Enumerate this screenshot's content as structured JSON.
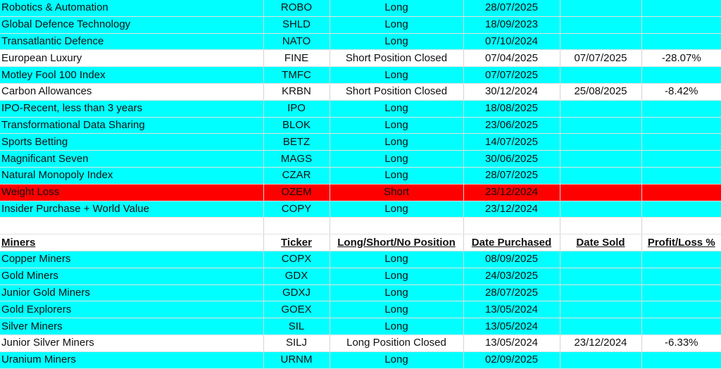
{
  "rows": [
    {
      "kind": "cyan",
      "cells": [
        "Robotics & Automation",
        "ROBO",
        "Long",
        "28/07/2025",
        "",
        ""
      ]
    },
    {
      "kind": "cyan",
      "cells": [
        "Global Defence Technology",
        "SHLD",
        "Long",
        "18/09/2023",
        "",
        ""
      ]
    },
    {
      "kind": "cyan",
      "cells": [
        "Transatlantic Defence",
        "NATO",
        "Long",
        "07/10/2024",
        "",
        ""
      ]
    },
    {
      "kind": "white",
      "cells": [
        "European Luxury",
        "FINE",
        "Short Position Closed",
        "07/04/2025",
        "07/07/2025",
        "-28.07%"
      ]
    },
    {
      "kind": "cyan",
      "cells": [
        "Motley Fool 100 Index",
        "TMFC",
        "Long",
        "07/07/2025",
        "",
        ""
      ]
    },
    {
      "kind": "white",
      "cells": [
        "Carbon Allowances",
        "KRBN",
        "Short Position Closed",
        "30/12/2024",
        "25/08/2025",
        "-8.42%"
      ]
    },
    {
      "kind": "cyan",
      "cells": [
        "IPO-Recent, less than 3 years",
        "IPO",
        "Long",
        "18/08/2025",
        "",
        ""
      ]
    },
    {
      "kind": "cyan",
      "cells": [
        "Transformational Data Sharing",
        "BLOK",
        "Long",
        "23/06/2025",
        "",
        ""
      ]
    },
    {
      "kind": "cyan",
      "cells": [
        "Sports Betting",
        "BETZ",
        "Long",
        "14/07/2025",
        "",
        ""
      ]
    },
    {
      "kind": "cyan",
      "cells": [
        "Magnificant Seven",
        "MAGS",
        "Long",
        "30/06/2025",
        "",
        ""
      ]
    },
    {
      "kind": "cyan",
      "cells": [
        "Natural Monopoly Index",
        "CZAR",
        "Long",
        "28/07/2025",
        "",
        ""
      ]
    },
    {
      "kind": "red",
      "cells": [
        "Weight Loss",
        "OZEM",
        "Short",
        "23/12/2024",
        "",
        ""
      ]
    },
    {
      "kind": "cyan",
      "cells": [
        "Insider Purchase + World Value",
        "COPY",
        "Long",
        "23/12/2024",
        "",
        ""
      ]
    },
    {
      "kind": "blank",
      "cells": [
        "",
        "",
        "",
        "",
        "",
        ""
      ]
    },
    {
      "kind": "header",
      "cells": [
        "Miners",
        "Ticker",
        "Long/Short/No Position",
        "Date Purchased",
        "Date Sold",
        "Profit/Loss %"
      ]
    },
    {
      "kind": "cyan",
      "cells": [
        "Copper Miners",
        "COPX",
        "Long",
        "08/09/2025",
        "",
        ""
      ]
    },
    {
      "kind": "cyan",
      "cells": [
        "Gold Miners",
        "GDX",
        "Long",
        "24/03/2025",
        "",
        ""
      ]
    },
    {
      "kind": "cyan",
      "cells": [
        "Junior Gold Miners",
        "GDXJ",
        "Long",
        "28/07/2025",
        "",
        ""
      ]
    },
    {
      "kind": "cyan",
      "cells": [
        "Gold Explorers",
        "GOEX",
        "Long",
        "13/05/2024",
        "",
        ""
      ]
    },
    {
      "kind": "cyan",
      "cells": [
        "Silver Miners",
        "SIL",
        "Long",
        "13/05/2024",
        "",
        ""
      ]
    },
    {
      "kind": "white",
      "cells": [
        "Junior Silver Miners",
        "SILJ",
        "Long Position Closed",
        "13/05/2024",
        "23/12/2024",
        "-6.33%"
      ]
    },
    {
      "kind": "cyan",
      "cells": [
        "Uranium Miners",
        "URNM",
        "Long",
        "02/09/2025",
        "",
        ""
      ]
    }
  ],
  "colors": {
    "cyan": "#00ffff",
    "red": "#ff0000",
    "white": "#ffffff"
  }
}
